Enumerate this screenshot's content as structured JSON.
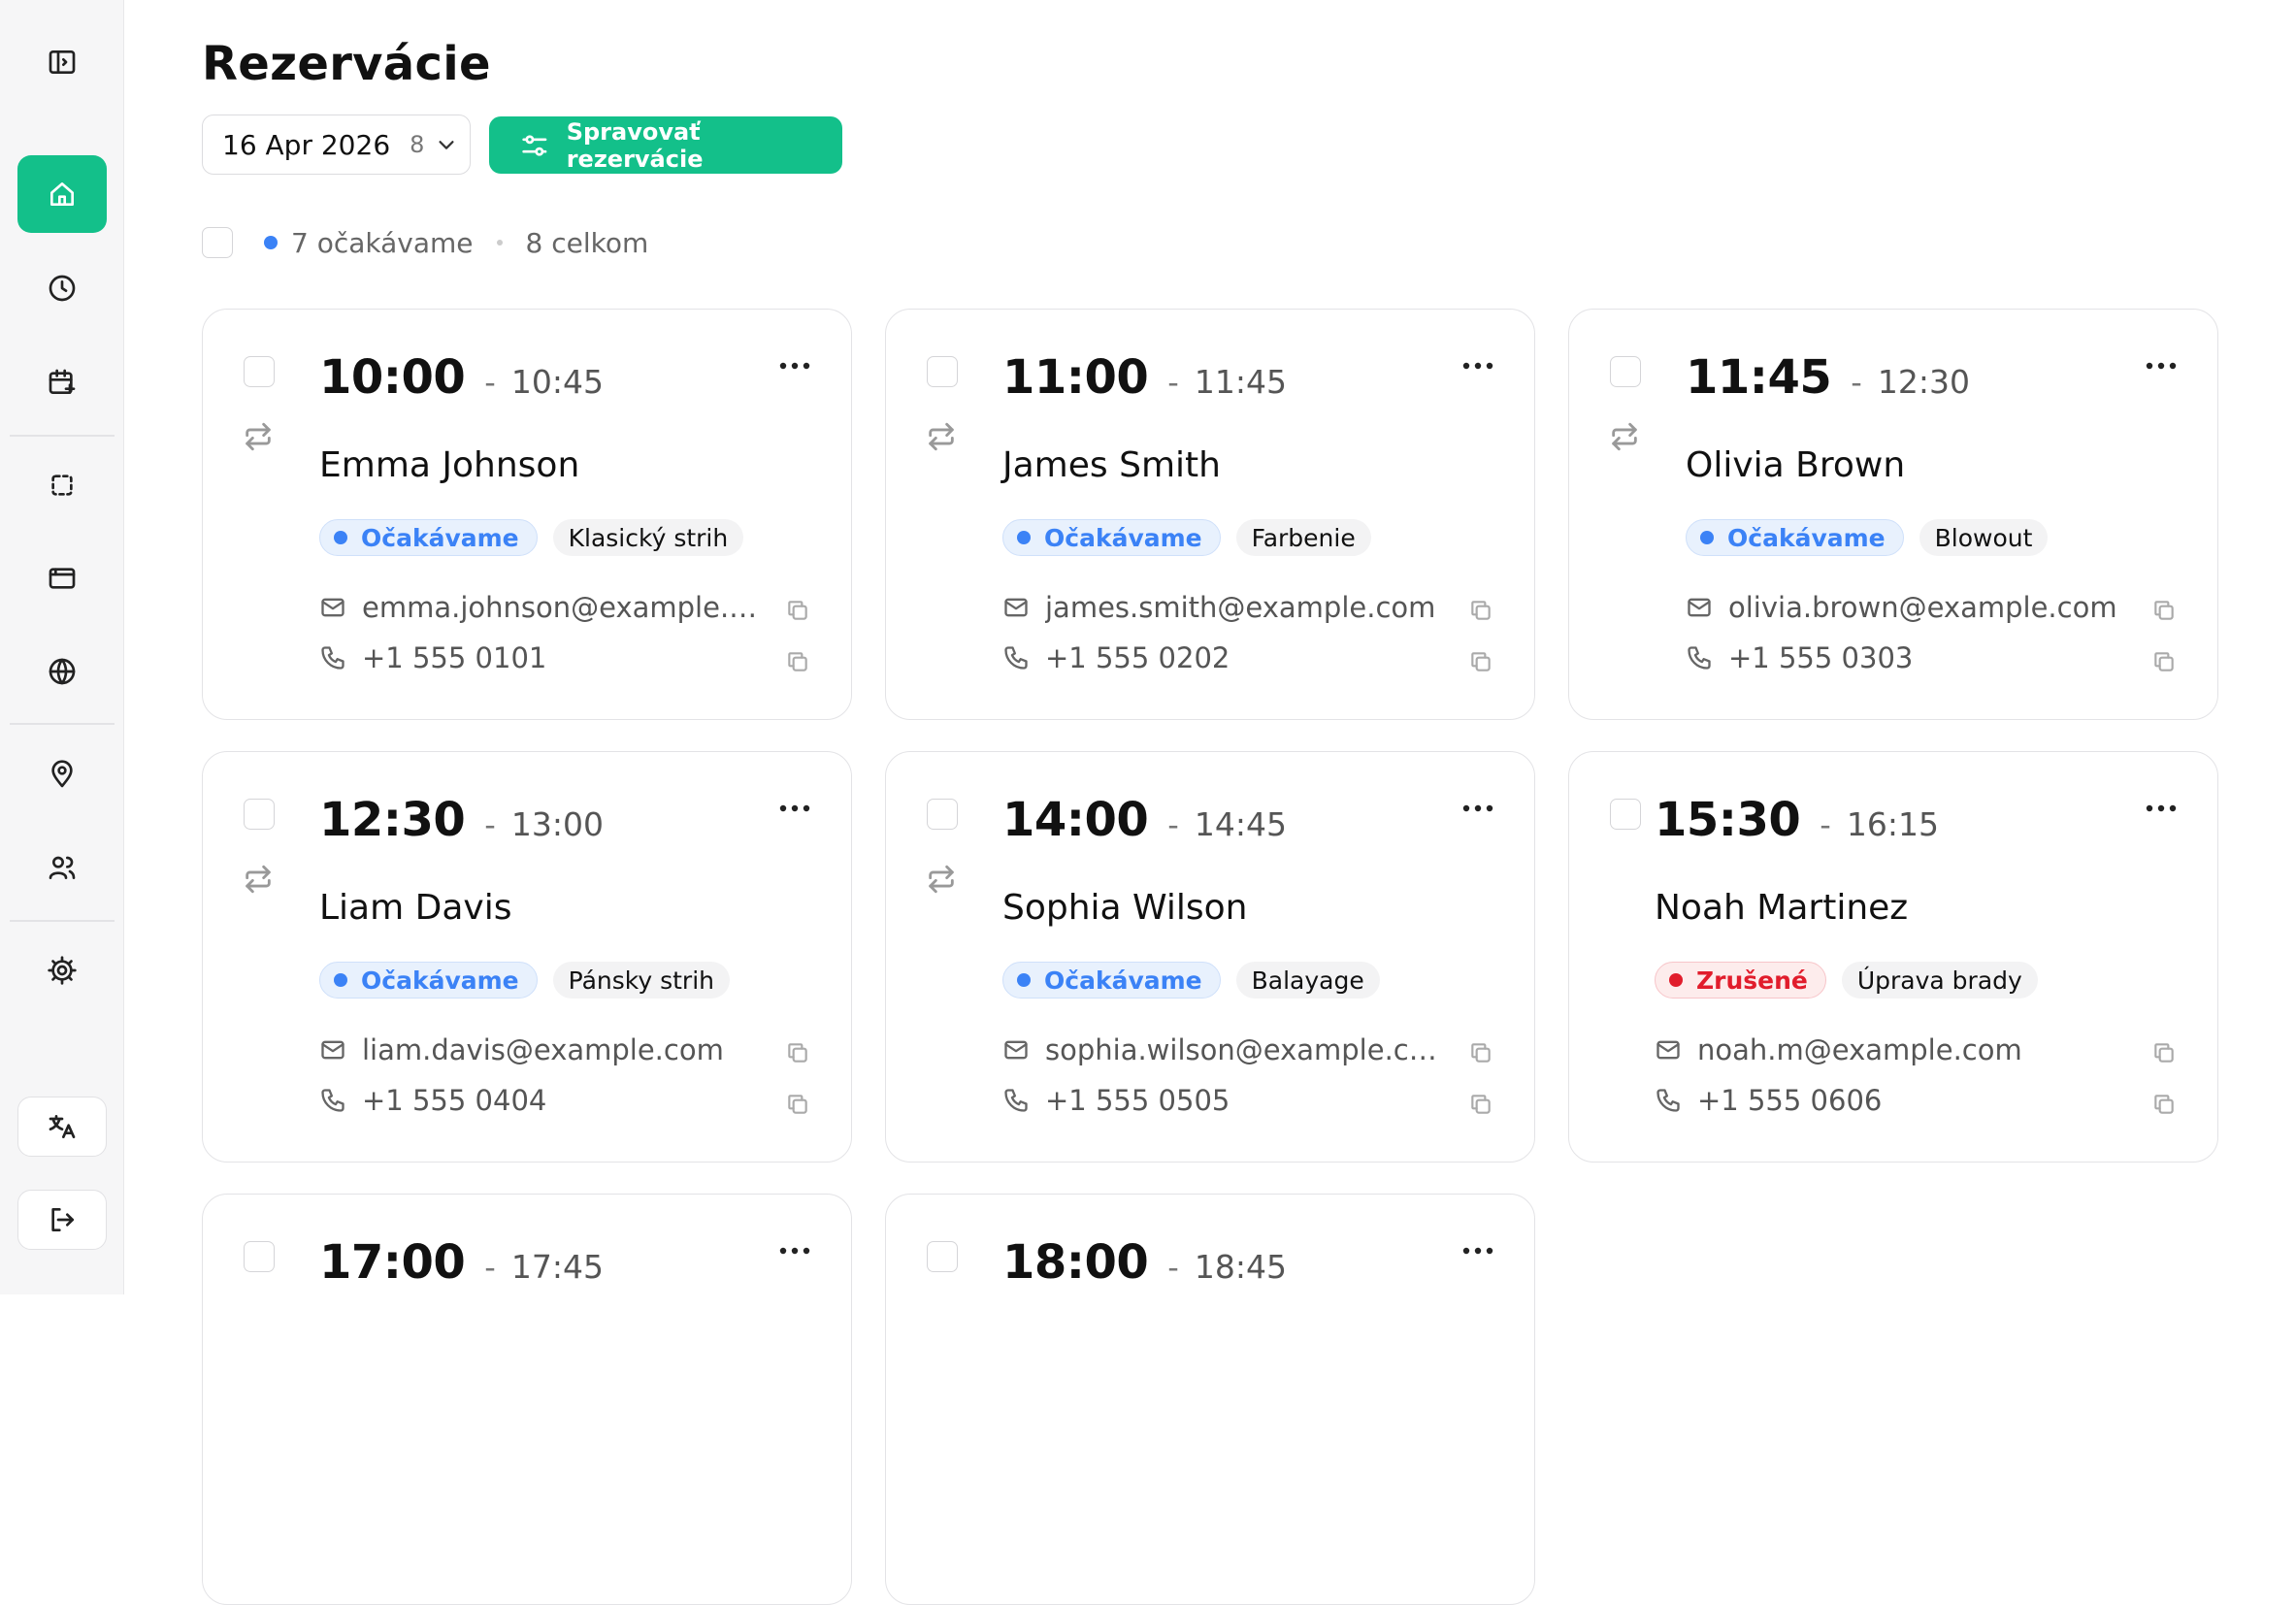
{
  "page": {
    "title": "Rezervácie",
    "date_select": {
      "value": "16 Apr 2026",
      "count": "8"
    },
    "manage_button": "Spravovať rezervácie",
    "summary": {
      "expected": "7 očakávame",
      "total": "8 celkom"
    }
  },
  "sidebar": {
    "items": [
      {
        "icon": "sidebar-toggle-icon"
      },
      {
        "icon": "home-icon",
        "active": true
      },
      {
        "icon": "clock-icon"
      },
      {
        "icon": "calendar-plus-icon"
      },
      {
        "icon": "dashed-square-icon"
      },
      {
        "icon": "browser-window-icon"
      },
      {
        "icon": "globe-icon"
      },
      {
        "icon": "map-pin-icon"
      },
      {
        "icon": "users-icon"
      },
      {
        "icon": "gear-icon"
      },
      {
        "icon": "translate-icon"
      },
      {
        "icon": "logout-icon"
      }
    ]
  },
  "colors": {
    "accent": "#13c08a",
    "expected": "#3b82f6",
    "cancelled": "#e11d2c"
  },
  "reservations": [
    {
      "start": "10:00",
      "end": "10:45",
      "name": "Emma Johnson",
      "status": "Očakávame",
      "status_type": "expected",
      "service": "Klasický strih",
      "email": "emma.johnson@example.co...",
      "phone": "+1 555 0101",
      "recurring": true
    },
    {
      "start": "11:00",
      "end": "11:45",
      "name": "James Smith",
      "status": "Očakávame",
      "status_type": "expected",
      "service": "Farbenie",
      "email": "james.smith@example.com",
      "phone": "+1 555 0202",
      "recurring": true
    },
    {
      "start": "11:45",
      "end": "12:30",
      "name": "Olivia Brown",
      "status": "Očakávame",
      "status_type": "expected",
      "service": "Blowout",
      "email": "olivia.brown@example.com",
      "phone": "+1 555 0303",
      "recurring": true
    },
    {
      "start": "12:30",
      "end": "13:00",
      "name": "Liam Davis",
      "status": "Očakávame",
      "status_type": "expected",
      "service": "Pánsky strih",
      "email": "liam.davis@example.com",
      "phone": "+1 555 0404",
      "recurring": true
    },
    {
      "start": "14:00",
      "end": "14:45",
      "name": "Sophia Wilson",
      "status": "Očakávame",
      "status_type": "expected",
      "service": "Balayage",
      "email": "sophia.wilson@example.com",
      "phone": "+1 555 0505",
      "recurring": true
    },
    {
      "start": "15:30",
      "end": "16:15",
      "name": "Noah Martinez",
      "status": "Zrušené",
      "status_type": "cancelled",
      "service": "Úprava brady",
      "email": "noah.m@example.com",
      "phone": "+1 555 0606",
      "recurring": false
    },
    {
      "start": "17:00",
      "end": "17:45"
    },
    {
      "start": "18:00",
      "end": "18:45"
    }
  ]
}
